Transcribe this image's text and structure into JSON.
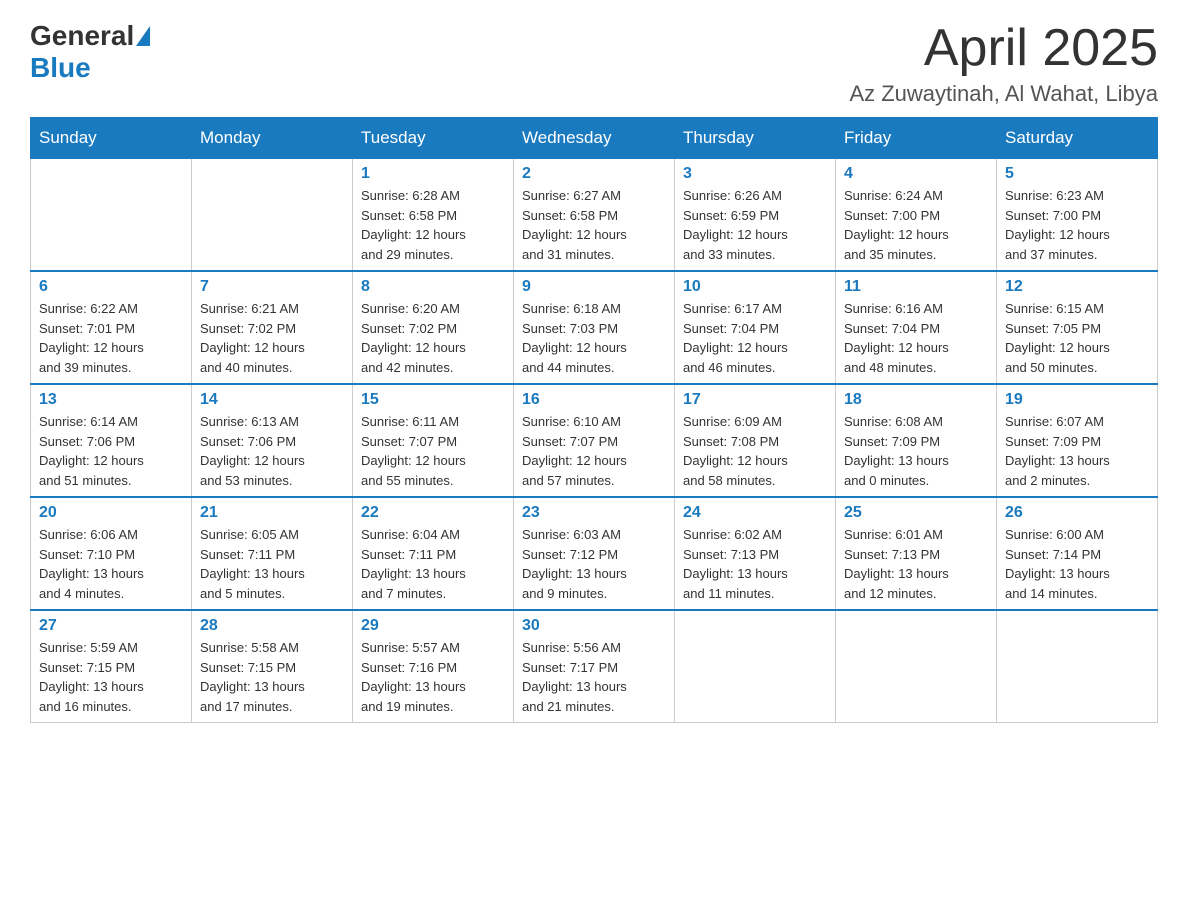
{
  "logo": {
    "general": "General",
    "blue": "Blue"
  },
  "title": "April 2025",
  "location": "Az Zuwaytinah, Al Wahat, Libya",
  "weekdays": [
    "Sunday",
    "Monday",
    "Tuesday",
    "Wednesday",
    "Thursday",
    "Friday",
    "Saturday"
  ],
  "weeks": [
    [
      {
        "day": "",
        "info": ""
      },
      {
        "day": "",
        "info": ""
      },
      {
        "day": "1",
        "info": "Sunrise: 6:28 AM\nSunset: 6:58 PM\nDaylight: 12 hours\nand 29 minutes."
      },
      {
        "day": "2",
        "info": "Sunrise: 6:27 AM\nSunset: 6:58 PM\nDaylight: 12 hours\nand 31 minutes."
      },
      {
        "day": "3",
        "info": "Sunrise: 6:26 AM\nSunset: 6:59 PM\nDaylight: 12 hours\nand 33 minutes."
      },
      {
        "day": "4",
        "info": "Sunrise: 6:24 AM\nSunset: 7:00 PM\nDaylight: 12 hours\nand 35 minutes."
      },
      {
        "day": "5",
        "info": "Sunrise: 6:23 AM\nSunset: 7:00 PM\nDaylight: 12 hours\nand 37 minutes."
      }
    ],
    [
      {
        "day": "6",
        "info": "Sunrise: 6:22 AM\nSunset: 7:01 PM\nDaylight: 12 hours\nand 39 minutes."
      },
      {
        "day": "7",
        "info": "Sunrise: 6:21 AM\nSunset: 7:02 PM\nDaylight: 12 hours\nand 40 minutes."
      },
      {
        "day": "8",
        "info": "Sunrise: 6:20 AM\nSunset: 7:02 PM\nDaylight: 12 hours\nand 42 minutes."
      },
      {
        "day": "9",
        "info": "Sunrise: 6:18 AM\nSunset: 7:03 PM\nDaylight: 12 hours\nand 44 minutes."
      },
      {
        "day": "10",
        "info": "Sunrise: 6:17 AM\nSunset: 7:04 PM\nDaylight: 12 hours\nand 46 minutes."
      },
      {
        "day": "11",
        "info": "Sunrise: 6:16 AM\nSunset: 7:04 PM\nDaylight: 12 hours\nand 48 minutes."
      },
      {
        "day": "12",
        "info": "Sunrise: 6:15 AM\nSunset: 7:05 PM\nDaylight: 12 hours\nand 50 minutes."
      }
    ],
    [
      {
        "day": "13",
        "info": "Sunrise: 6:14 AM\nSunset: 7:06 PM\nDaylight: 12 hours\nand 51 minutes."
      },
      {
        "day": "14",
        "info": "Sunrise: 6:13 AM\nSunset: 7:06 PM\nDaylight: 12 hours\nand 53 minutes."
      },
      {
        "day": "15",
        "info": "Sunrise: 6:11 AM\nSunset: 7:07 PM\nDaylight: 12 hours\nand 55 minutes."
      },
      {
        "day": "16",
        "info": "Sunrise: 6:10 AM\nSunset: 7:07 PM\nDaylight: 12 hours\nand 57 minutes."
      },
      {
        "day": "17",
        "info": "Sunrise: 6:09 AM\nSunset: 7:08 PM\nDaylight: 12 hours\nand 58 minutes."
      },
      {
        "day": "18",
        "info": "Sunrise: 6:08 AM\nSunset: 7:09 PM\nDaylight: 13 hours\nand 0 minutes."
      },
      {
        "day": "19",
        "info": "Sunrise: 6:07 AM\nSunset: 7:09 PM\nDaylight: 13 hours\nand 2 minutes."
      }
    ],
    [
      {
        "day": "20",
        "info": "Sunrise: 6:06 AM\nSunset: 7:10 PM\nDaylight: 13 hours\nand 4 minutes."
      },
      {
        "day": "21",
        "info": "Sunrise: 6:05 AM\nSunset: 7:11 PM\nDaylight: 13 hours\nand 5 minutes."
      },
      {
        "day": "22",
        "info": "Sunrise: 6:04 AM\nSunset: 7:11 PM\nDaylight: 13 hours\nand 7 minutes."
      },
      {
        "day": "23",
        "info": "Sunrise: 6:03 AM\nSunset: 7:12 PM\nDaylight: 13 hours\nand 9 minutes."
      },
      {
        "day": "24",
        "info": "Sunrise: 6:02 AM\nSunset: 7:13 PM\nDaylight: 13 hours\nand 11 minutes."
      },
      {
        "day": "25",
        "info": "Sunrise: 6:01 AM\nSunset: 7:13 PM\nDaylight: 13 hours\nand 12 minutes."
      },
      {
        "day": "26",
        "info": "Sunrise: 6:00 AM\nSunset: 7:14 PM\nDaylight: 13 hours\nand 14 minutes."
      }
    ],
    [
      {
        "day": "27",
        "info": "Sunrise: 5:59 AM\nSunset: 7:15 PM\nDaylight: 13 hours\nand 16 minutes."
      },
      {
        "day": "28",
        "info": "Sunrise: 5:58 AM\nSunset: 7:15 PM\nDaylight: 13 hours\nand 17 minutes."
      },
      {
        "day": "29",
        "info": "Sunrise: 5:57 AM\nSunset: 7:16 PM\nDaylight: 13 hours\nand 19 minutes."
      },
      {
        "day": "30",
        "info": "Sunrise: 5:56 AM\nSunset: 7:17 PM\nDaylight: 13 hours\nand 21 minutes."
      },
      {
        "day": "",
        "info": ""
      },
      {
        "day": "",
        "info": ""
      },
      {
        "day": "",
        "info": ""
      }
    ]
  ]
}
